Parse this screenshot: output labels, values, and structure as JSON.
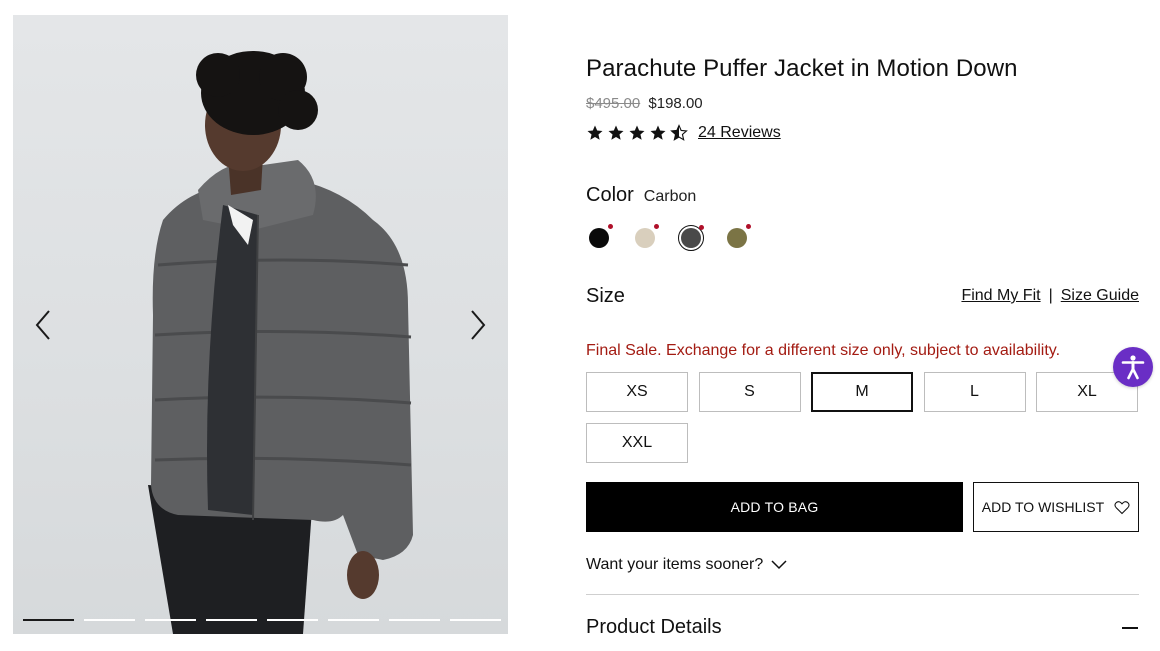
{
  "product": {
    "title": "Parachute Puffer Jacket in Motion Down",
    "old_price": "$495.00",
    "price": "$198.00",
    "rating": 4.5,
    "reviews_label": "24 Reviews"
  },
  "color": {
    "label": "Color",
    "selected": "Carbon",
    "swatches": [
      {
        "name": "Black",
        "hex": "#0a0a0a"
      },
      {
        "name": "Stone",
        "hex": "#d9cfbd"
      },
      {
        "name": "Carbon",
        "hex": "#4a4a4a"
      },
      {
        "name": "Olive",
        "hex": "#7b7445"
      }
    ]
  },
  "size": {
    "label": "Size",
    "find_fit": "Find My Fit",
    "separator": "|",
    "size_guide": "Size Guide",
    "final_sale": "Final Sale. Exchange for a different size only, subject to availability.",
    "options": [
      "XS",
      "S",
      "M",
      "L",
      "XL",
      "XXL"
    ],
    "selected": "M"
  },
  "actions": {
    "add_to_bag": "ADD TO BAG",
    "add_to_wishlist": "ADD TO WISHLIST"
  },
  "delivery": {
    "sooner": "Want your items sooner?"
  },
  "details": {
    "label": "Product Details"
  },
  "gallery": {
    "image_count": 8,
    "active_index": 0
  },
  "icons": {
    "prev": "chevron-left-icon",
    "next": "chevron-right-icon",
    "heart": "heart-icon",
    "chevron_down": "chevron-down-icon",
    "minus": "minus-icon",
    "accessibility": "accessibility-icon"
  },
  "colors": {
    "sale_text": "#a31b12",
    "accessibility_bg": "#6a2ec5",
    "button_bg": "#000000"
  }
}
